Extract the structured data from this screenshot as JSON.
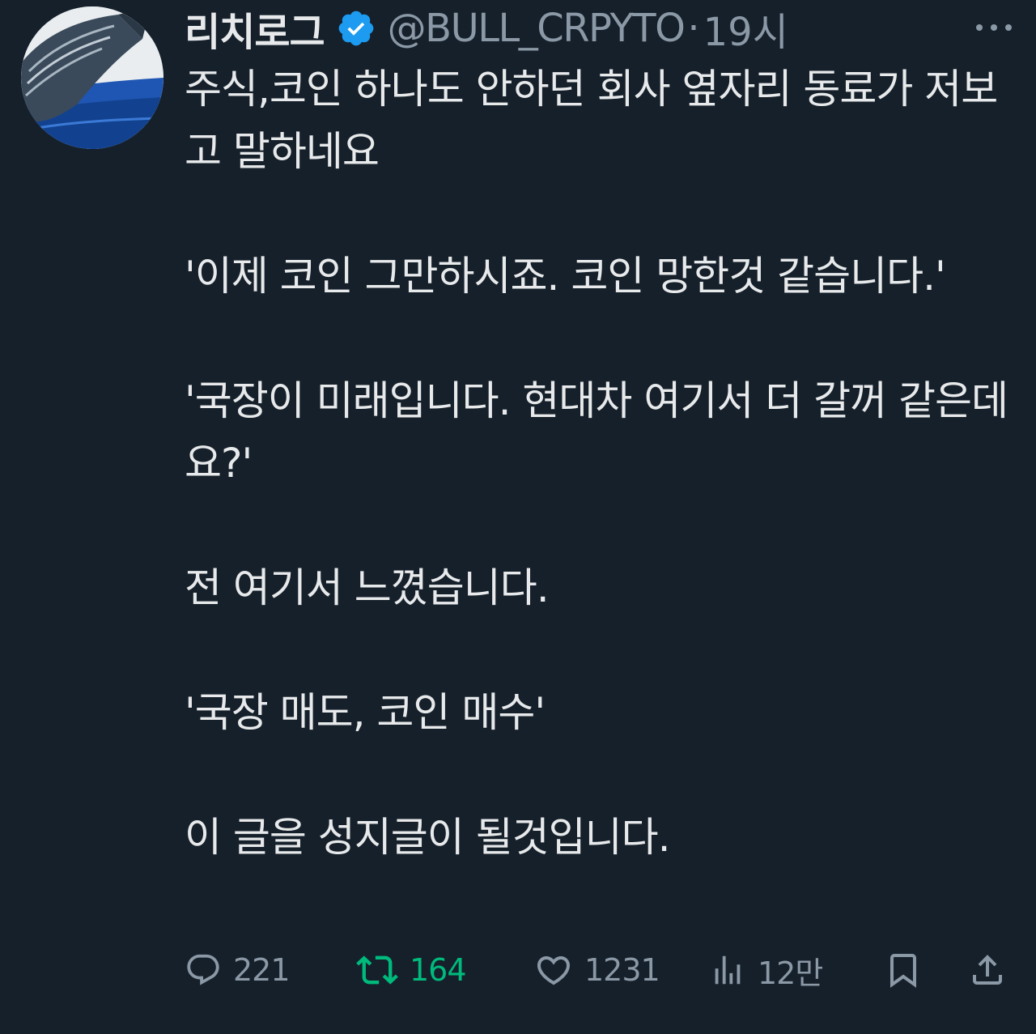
{
  "tweet": {
    "author": {
      "display_name": "리치로그",
      "handle": "@BULL_CRPYTO",
      "separator": "·",
      "time": "19시",
      "verified_icon": "verified-badge-icon",
      "avatar_icon": "whale-avatar"
    },
    "paragraphs": [
      "주식,코인 하나도 안하던 회사 옆자리 동료가 저보고 말하네요",
      "'이제 코인 그만하시죠. 코인 망한것 같습니다.'",
      "'국장이 미래입니다. 현대차 여기서 더 갈꺼 같은데요?'",
      "전 여기서 느꼈습니다.",
      "'국장 매도, 코인 매수'",
      "이 글을 성지글이 될것입니다."
    ],
    "actions": {
      "reply_count": "221",
      "retweet_count": "164",
      "like_count": "1231",
      "views_count": "12만"
    },
    "colors": {
      "background": "#15202b",
      "text": "#e7e9ea",
      "muted": "#8b98a5",
      "verified": "#1d9bf0",
      "retweet_active": "#00ba7c"
    }
  }
}
